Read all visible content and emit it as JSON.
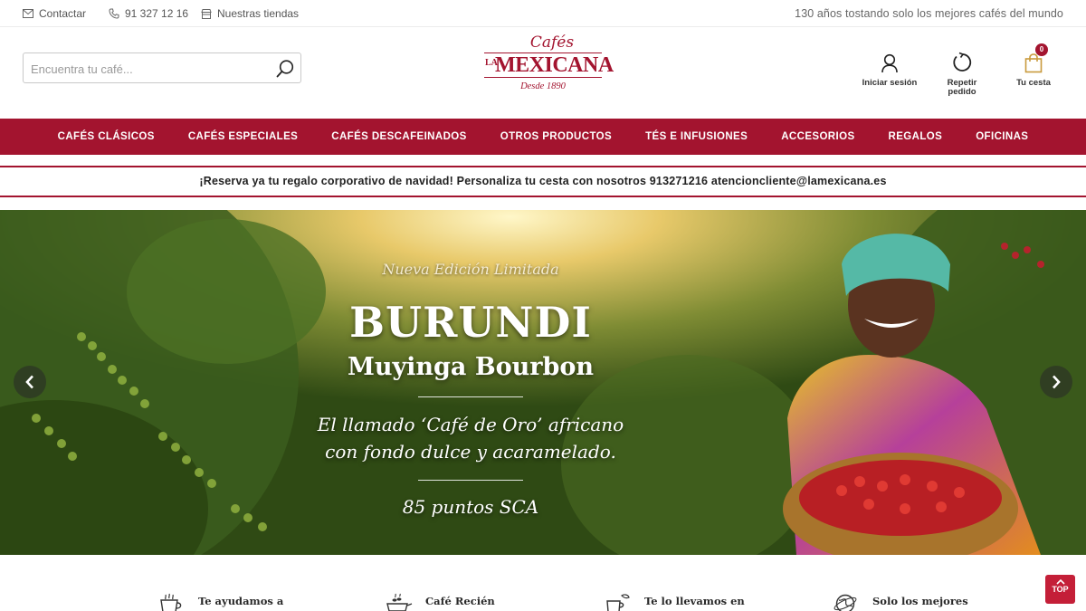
{
  "topbar": {
    "contact_label": "Contactar",
    "phone_label": "91 327 12 16",
    "stores_label": "Nuestras tiendas",
    "tagline": "130 años tostando solo los mejores cafés del mundo"
  },
  "header": {
    "search_placeholder": "Encuentra tu café...",
    "logo": {
      "top": "Cafés",
      "prefix": "LA",
      "name": "MEXICANA",
      "since": "Desde 1890"
    },
    "login_label": "Iniciar sesión",
    "reorder_label_1": "Repetir",
    "reorder_label_2": "pedido",
    "cart_label": "Tu cesta",
    "cart_count": "0"
  },
  "nav": {
    "items": [
      "CAFÉS CLÁSICOS",
      "CAFÉS ESPECIALES",
      "CAFÉS DESCAFEINADOS",
      "OTROS PRODUCTOS",
      "TÉS E INFUSIONES",
      "ACCESORIOS",
      "REGALOS",
      "OFICINAS"
    ]
  },
  "promo": {
    "text": "¡Reserva ya tu regalo corporativo de navidad! Personaliza tu cesta con nosotros 913271216 atencioncliente@lamexicana.es"
  },
  "hero": {
    "edition": "Nueva Edición Limitada",
    "title": "BURUNDI",
    "subtitle": "Muyinga Bourbon",
    "desc_line1": "El llamado ‘Café de Oro’ africano",
    "desc_line2": "con fondo dulce y acaramelado.",
    "score": "85 puntos SCA"
  },
  "benefits": [
    "Te ayudamos a",
    "Café Recién",
    "Te lo llevamos en",
    "Solo los mejores"
  ],
  "back_to_top": "TOP",
  "colors": {
    "brand_red": "#a3142f",
    "top_button": "#c41f38"
  }
}
